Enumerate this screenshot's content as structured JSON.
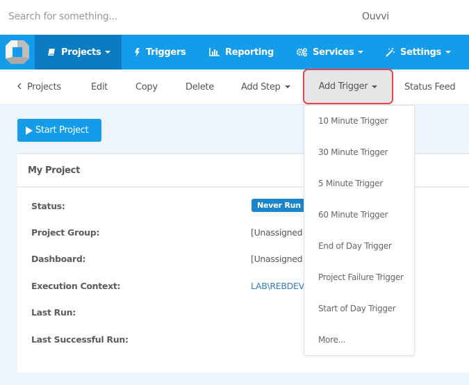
{
  "topbar": {
    "search_placeholder": "Search for something...",
    "username": "Ouvvi"
  },
  "navbar": {
    "logo": "ouvvi-logo",
    "items": [
      {
        "label": "Projects",
        "icon": "book-icon",
        "has_caret": true,
        "active": true
      },
      {
        "label": "Triggers",
        "icon": "bolt-icon",
        "has_caret": false,
        "active": false
      },
      {
        "label": "Reporting",
        "icon": "bar-chart-icon",
        "has_caret": false,
        "active": false
      },
      {
        "label": "Services",
        "icon": "gears-icon",
        "has_caret": true,
        "active": false
      },
      {
        "label": "Settings",
        "icon": "magic-wand-icon",
        "has_caret": true,
        "active": false
      }
    ]
  },
  "subnav": {
    "back_label": "Projects",
    "items": [
      {
        "label": "Edit"
      },
      {
        "label": "Copy"
      },
      {
        "label": "Delete"
      },
      {
        "label": "Add Step",
        "has_caret": true
      },
      {
        "label": "Add Trigger",
        "has_caret": true,
        "highlighted": true
      },
      {
        "label": "Status Feed"
      }
    ]
  },
  "start_button": {
    "label": "Start Project",
    "icon": "play-icon"
  },
  "project": {
    "title": "My Project",
    "fields": [
      {
        "label": "Status:",
        "value": "Never Run",
        "type": "badge"
      },
      {
        "label": "Project Group:",
        "value": "[Unassigned"
      },
      {
        "label": "Dashboard:",
        "value": "[Unassigned"
      },
      {
        "label": "Execution Context:",
        "value": "LAB\\REBDEV",
        "type": "link"
      },
      {
        "label": "Last Run:",
        "value": ""
      },
      {
        "label": "Last Successful Run:",
        "value": ""
      }
    ]
  },
  "add_trigger_menu": {
    "items": [
      "10 Minute Trigger",
      "30 Minute Trigger",
      "5 Minute Trigger",
      "60 Minute Trigger",
      "End of Day Trigger",
      "Project Failure Trigger",
      "Start of Day Trigger",
      "More..."
    ]
  },
  "colors": {
    "brand_blue": "#149cea",
    "active_nav": "#0b7cc1",
    "highlight_border": "#e8444d",
    "badge_blue": "#1a84cc",
    "link_blue": "#2e7dc1",
    "page_bg": "#edf5fc"
  }
}
